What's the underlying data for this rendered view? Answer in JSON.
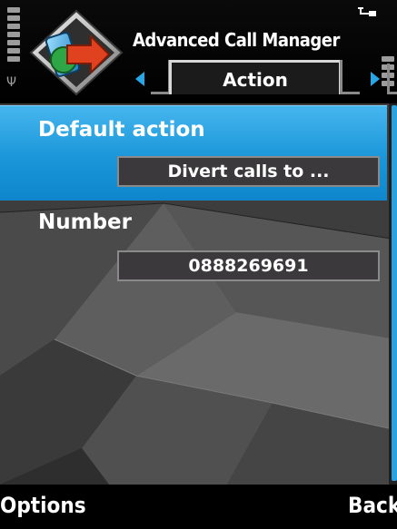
{
  "app": {
    "title": "Advanced Call Manager"
  },
  "tabs": {
    "active_label": "Action"
  },
  "form": {
    "default_action_label": "Default action",
    "default_action_value": "Divert calls to ...",
    "number_label": "Number",
    "number_value": "0888269691"
  },
  "softkeys": {
    "left": "Options",
    "right": "Back"
  },
  "icons": {
    "signal": "signal-strength-icon",
    "battery": "battery-level-icon",
    "data": "packet-data-icon",
    "app": "call-manager-app-icon",
    "tab_prev": "tab-prev-arrow-icon",
    "tab_next": "tab-next-arrow-icon"
  },
  "colors": {
    "selection": "#1a96d9",
    "accent": "#28a7e6",
    "value_box": "#3b393b"
  }
}
